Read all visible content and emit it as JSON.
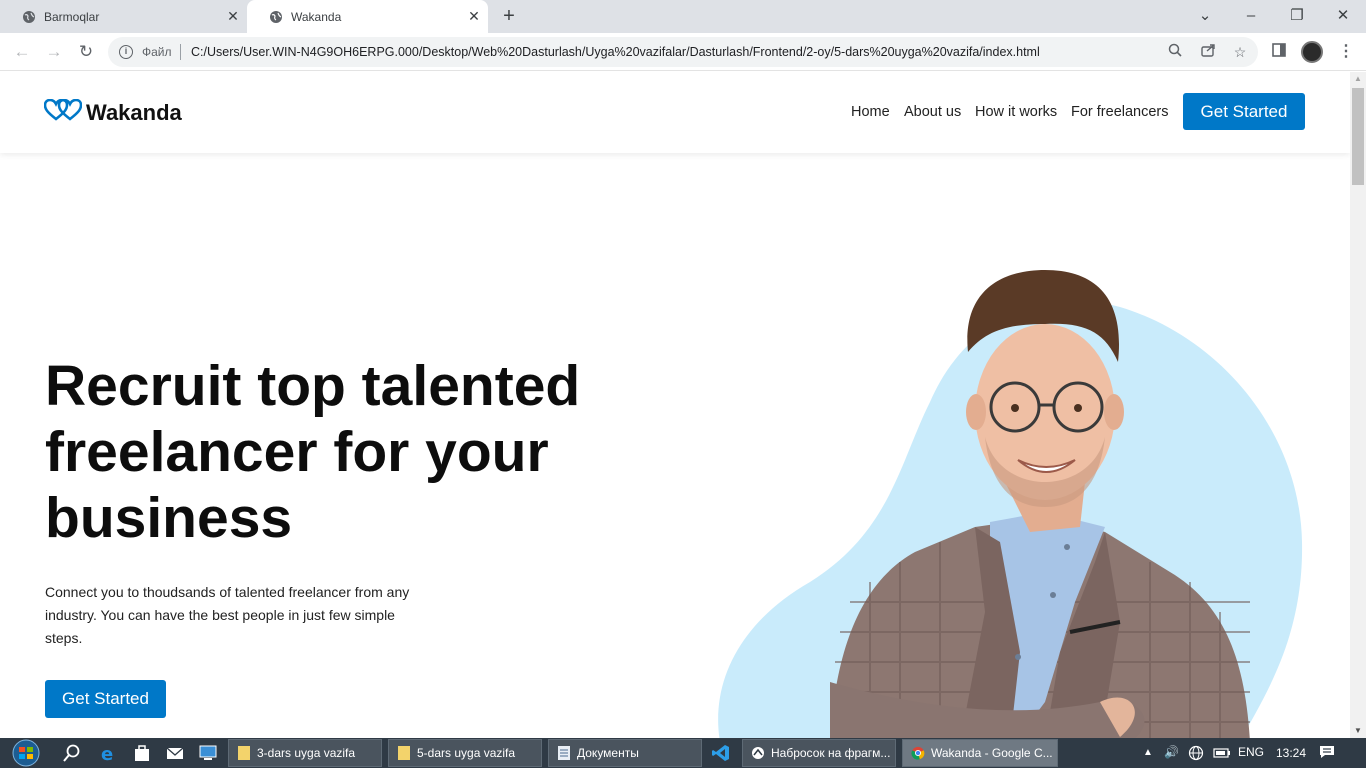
{
  "browser": {
    "tabs": [
      {
        "title": "Barmoqlar",
        "active": false
      },
      {
        "title": "Wakanda",
        "active": true
      }
    ],
    "address": {
      "scheme_label": "Файл",
      "url": "C:/Users/User.WIN-N4G9OH6ERPG.000/Desktop/Web%20Dasturlash/Uyga%20vazifalar/Dasturlash/Frontend/2-oy/5-dars%20uyga%20vazifa/index.html"
    }
  },
  "site": {
    "logo_text": "Wakanda",
    "nav": [
      "Home",
      "About us",
      "How it works",
      "For freelancers"
    ],
    "header_cta": "Get Started",
    "hero": {
      "title": "Recruit top talented freelancer for your business",
      "subtitle": "Connect you to thoudsands of talented freelancer from any industry. You can have the best people in just few simple steps.",
      "cta": "Get Started"
    },
    "colors": {
      "brand": "#0078c8",
      "blob": "#c9ebfb"
    }
  },
  "taskbar": {
    "windows": [
      {
        "label": "3-dars uyga vazifa",
        "icon": "folder-icon"
      },
      {
        "label": "5-dars uyga vazifa",
        "icon": "folder-icon"
      },
      {
        "label": "Документы",
        "icon": "document-icon"
      },
      {
        "label": "Набросок на фрагм...",
        "icon": "snip-icon"
      },
      {
        "label": "Wakanda - Google C...",
        "icon": "chrome-icon"
      }
    ],
    "language": "ENG",
    "time": "13:24"
  }
}
